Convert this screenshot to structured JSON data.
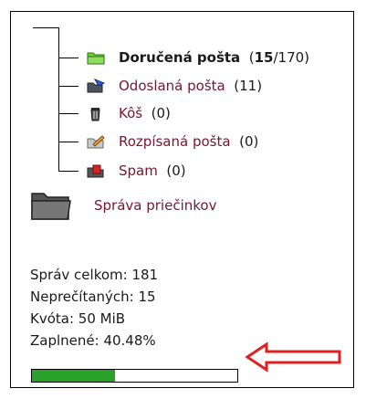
{
  "folders": [
    {
      "name": "Doručená pošta",
      "count_open": "(",
      "unread": "15",
      "total": "/170)",
      "icon": "inbox-icon",
      "bold": true
    },
    {
      "name": "Odoslaná pošta",
      "count": "(11)",
      "icon": "sent-icon"
    },
    {
      "name": "Kôš",
      "count": "(0)",
      "icon": "trash-icon"
    },
    {
      "name": "Rozpísaná pošta",
      "count": "(0)",
      "icon": "drafts-icon"
    },
    {
      "name": "Spam",
      "count": "(0)",
      "icon": "spam-icon"
    }
  ],
  "manage_folders": "Správa priečinkov",
  "stats": {
    "total": "Správ celkom: 181",
    "unread": "Neprečítaných: 15",
    "quota": "Kvóta: 50 MiB",
    "used": "Zaplnené: 40.48%"
  },
  "quota_usage": 0.4048,
  "colors": {
    "link": "#7a1530",
    "bar_fill": "#2aa12a",
    "arrow": "#e02020"
  }
}
